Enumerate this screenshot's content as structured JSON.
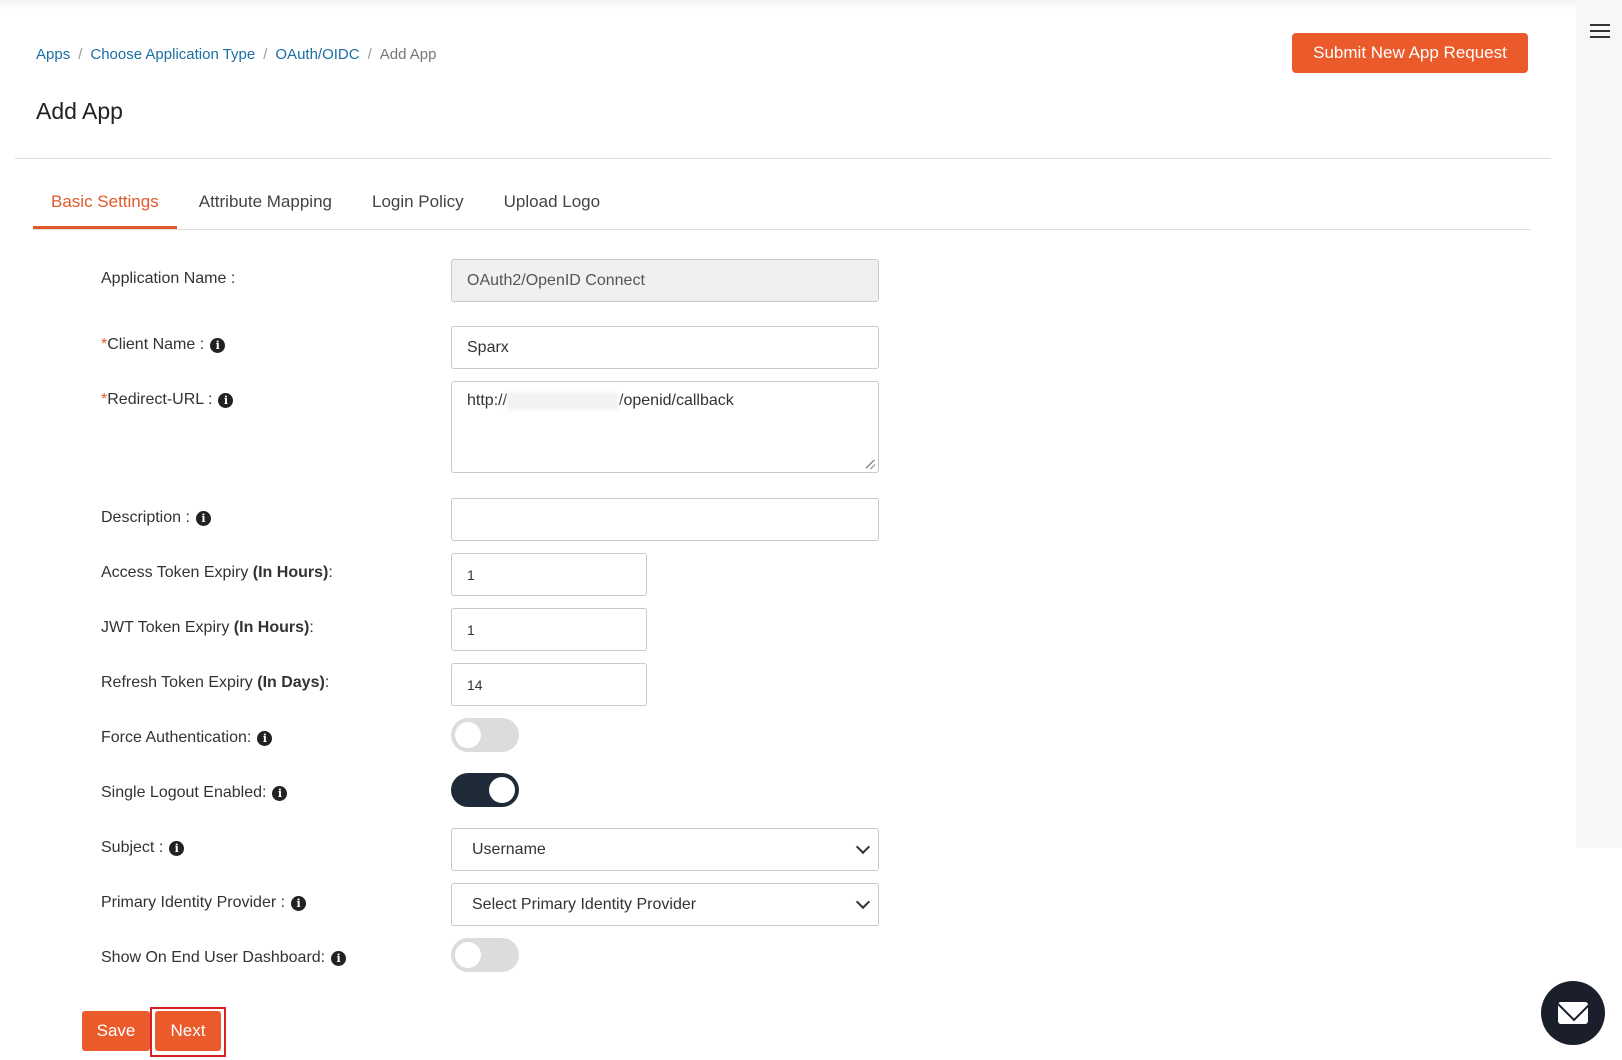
{
  "breadcrumb": {
    "items": [
      "Apps",
      "Choose Application Type",
      "OAuth/OIDC"
    ],
    "current": "Add App"
  },
  "header": {
    "submit_label": "Submit New App Request",
    "title": "Add App"
  },
  "tabs": [
    "Basic Settings",
    "Attribute Mapping",
    "Login Policy",
    "Upload Logo"
  ],
  "form": {
    "application_name": {
      "label": "Application Name :",
      "value": "OAuth2/OpenID Connect"
    },
    "client_name": {
      "required": "*",
      "label": "Client Name :",
      "value": "Sparx"
    },
    "redirect_url": {
      "required": "*",
      "label": "Redirect-URL :",
      "prefix": "http://",
      "suffix": "/openid/callback"
    },
    "description": {
      "label": "Description :",
      "value": ""
    },
    "access_token": {
      "label": "Access Token Expiry ",
      "unit": "(In Hours)",
      "colon": ":",
      "value": "1"
    },
    "jwt_token": {
      "label": "JWT Token Expiry ",
      "unit": "(In Hours)",
      "colon": ":",
      "value": "1"
    },
    "refresh_token": {
      "label": "Refresh Token Expiry ",
      "unit": "(In Days)",
      "colon": ":",
      "value": "14"
    },
    "force_auth": {
      "label": "Force Authentication:",
      "on": false
    },
    "single_logout": {
      "label": "Single Logout Enabled:",
      "on": true
    },
    "subject": {
      "label": "Subject :",
      "value": "Username"
    },
    "primary_idp": {
      "label": "Primary Identity Provider :",
      "value": "Select Primary Identity Provider"
    },
    "show_dashboard": {
      "label": "Show On End User Dashboard:",
      "on": false
    }
  },
  "buttons": {
    "save": "Save",
    "next": "Next"
  },
  "icons": {
    "info": "info-icon",
    "menu": "hamburger-icon",
    "mail": "mail-icon"
  },
  "colors": {
    "accent": "#ea5a2a",
    "link": "#1a6fa3",
    "toggle_on": "#1e2a38",
    "highlight": "#d81f26"
  }
}
